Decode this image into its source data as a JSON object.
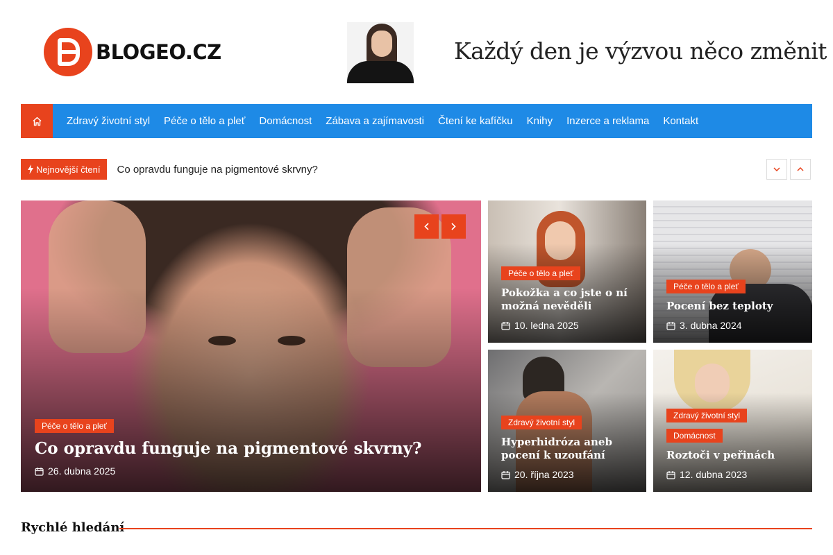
{
  "site": {
    "logo_text": "BLOGEO.CZ",
    "banner_slogan": "Každý den je výzvou něco změnit"
  },
  "nav": {
    "home_icon": "home-icon",
    "items": [
      {
        "label": "Zdravý životní styl"
      },
      {
        "label": "Péče o tělo a pleť"
      },
      {
        "label": "Domácnost"
      },
      {
        "label": "Zábava a zajímavosti"
      },
      {
        "label": "Čtení ke kafíčku"
      },
      {
        "label": "Knihy"
      },
      {
        "label": "Inzerce a reklama"
      },
      {
        "label": "Kontakt"
      }
    ]
  },
  "ticker": {
    "badge_label": "Nejnovější čtení",
    "badge_icon": "bolt-icon",
    "headline": "Co opravdu funguje na pigmentové skrvny?",
    "down_icon": "chevron-down-icon",
    "up_icon": "chevron-up-icon"
  },
  "featured": {
    "main": {
      "tag": "Péče o tělo a pleť",
      "title": "Co opravdu funguje na pigmentové skvrny?",
      "date": "26. dubna 2025"
    },
    "cards": [
      {
        "tags": [
          "Péče o tělo a pleť"
        ],
        "title": "Pokožka a co jste o ní možná nevěděli",
        "date": "10. ledna 2025"
      },
      {
        "tags": [
          "Péče o tělo a pleť"
        ],
        "title": "Pocení bez teploty",
        "date": "3. dubna 2024"
      },
      {
        "tags": [
          "Zdravý životní styl"
        ],
        "title": "Hyperhidróza aneb pocení k uzoufání",
        "date": "20. října 2023"
      },
      {
        "tags": [
          "Zdravý životní styl",
          "Domácnost"
        ],
        "title": "Roztoči v peřinách",
        "date": "12. dubna 2023"
      }
    ]
  },
  "quick_search": {
    "title": "Rychlé hledání"
  },
  "colors": {
    "accent": "#e8431d",
    "nav_bg": "#1e8ae6"
  }
}
